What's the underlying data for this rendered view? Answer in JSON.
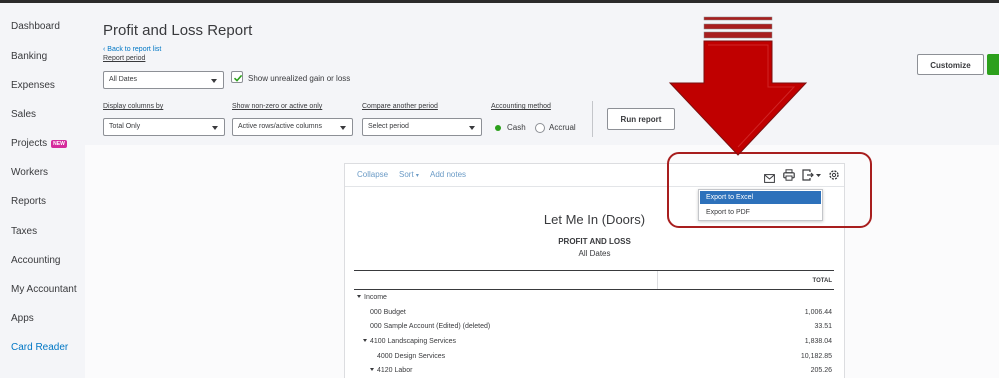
{
  "sidebar": {
    "items": [
      {
        "label": "Dashboard"
      },
      {
        "label": "Banking"
      },
      {
        "label": "Expenses"
      },
      {
        "label": "Sales"
      },
      {
        "label": "Projects",
        "badge": "NEW"
      },
      {
        "label": "Workers"
      },
      {
        "label": "Reports"
      },
      {
        "label": "Taxes"
      },
      {
        "label": "Accounting"
      },
      {
        "label": "My Accountant"
      },
      {
        "label": "Apps"
      },
      {
        "label": "Card Reader"
      }
    ]
  },
  "header": {
    "title": "Profit and Loss Report",
    "back_link": "Back to report list",
    "report_period_label": "Report period",
    "report_period_value": "All Dates",
    "unrealized_label": "Show unrealized gain or loss",
    "unrealized_checked": true,
    "display_columns_label": "Display columns by",
    "display_columns_value": "Total Only",
    "non_zero_label": "Show non-zero or active only",
    "non_zero_value": "Active rows/active columns",
    "compare_label": "Compare another period",
    "compare_value": "Select period",
    "accounting_label": "Accounting method",
    "cash_label": "Cash",
    "accrual_label": "Accrual",
    "accounting_selected": "Cash",
    "run_report": "Run report",
    "customize": "Customize"
  },
  "report": {
    "toolbar": {
      "collapse": "Collapse",
      "sort": "Sort",
      "add_notes": "Add notes"
    },
    "export_menu": {
      "items": [
        "Export to Excel",
        "Export to PDF"
      ],
      "highlighted": "Export to Excel"
    },
    "company": "Let Me In (Doors)",
    "title": "PROFIT AND LOSS",
    "subtitle": "All Dates",
    "column_header": "TOTAL",
    "rows": [
      {
        "label": "Income",
        "value": "",
        "expander": true
      },
      {
        "label": "000 Budget",
        "value": "1,006.44"
      },
      {
        "label": "000 Sample Account (Edited) (deleted)",
        "value": "33.51"
      },
      {
        "label": "4100 Landscaping Services",
        "value": "1,838.04",
        "expander": true
      },
      {
        "label": "4000 Design Services",
        "value": "10,182.85"
      },
      {
        "label": "4120 Labor",
        "value": "205.26",
        "expander": true
      }
    ]
  },
  "colors": {
    "accent_blue": "#0077c5",
    "brand_green": "#2ca01c",
    "annotation_red": "#a81e1e",
    "menu_highlight": "#2d71bb"
  }
}
